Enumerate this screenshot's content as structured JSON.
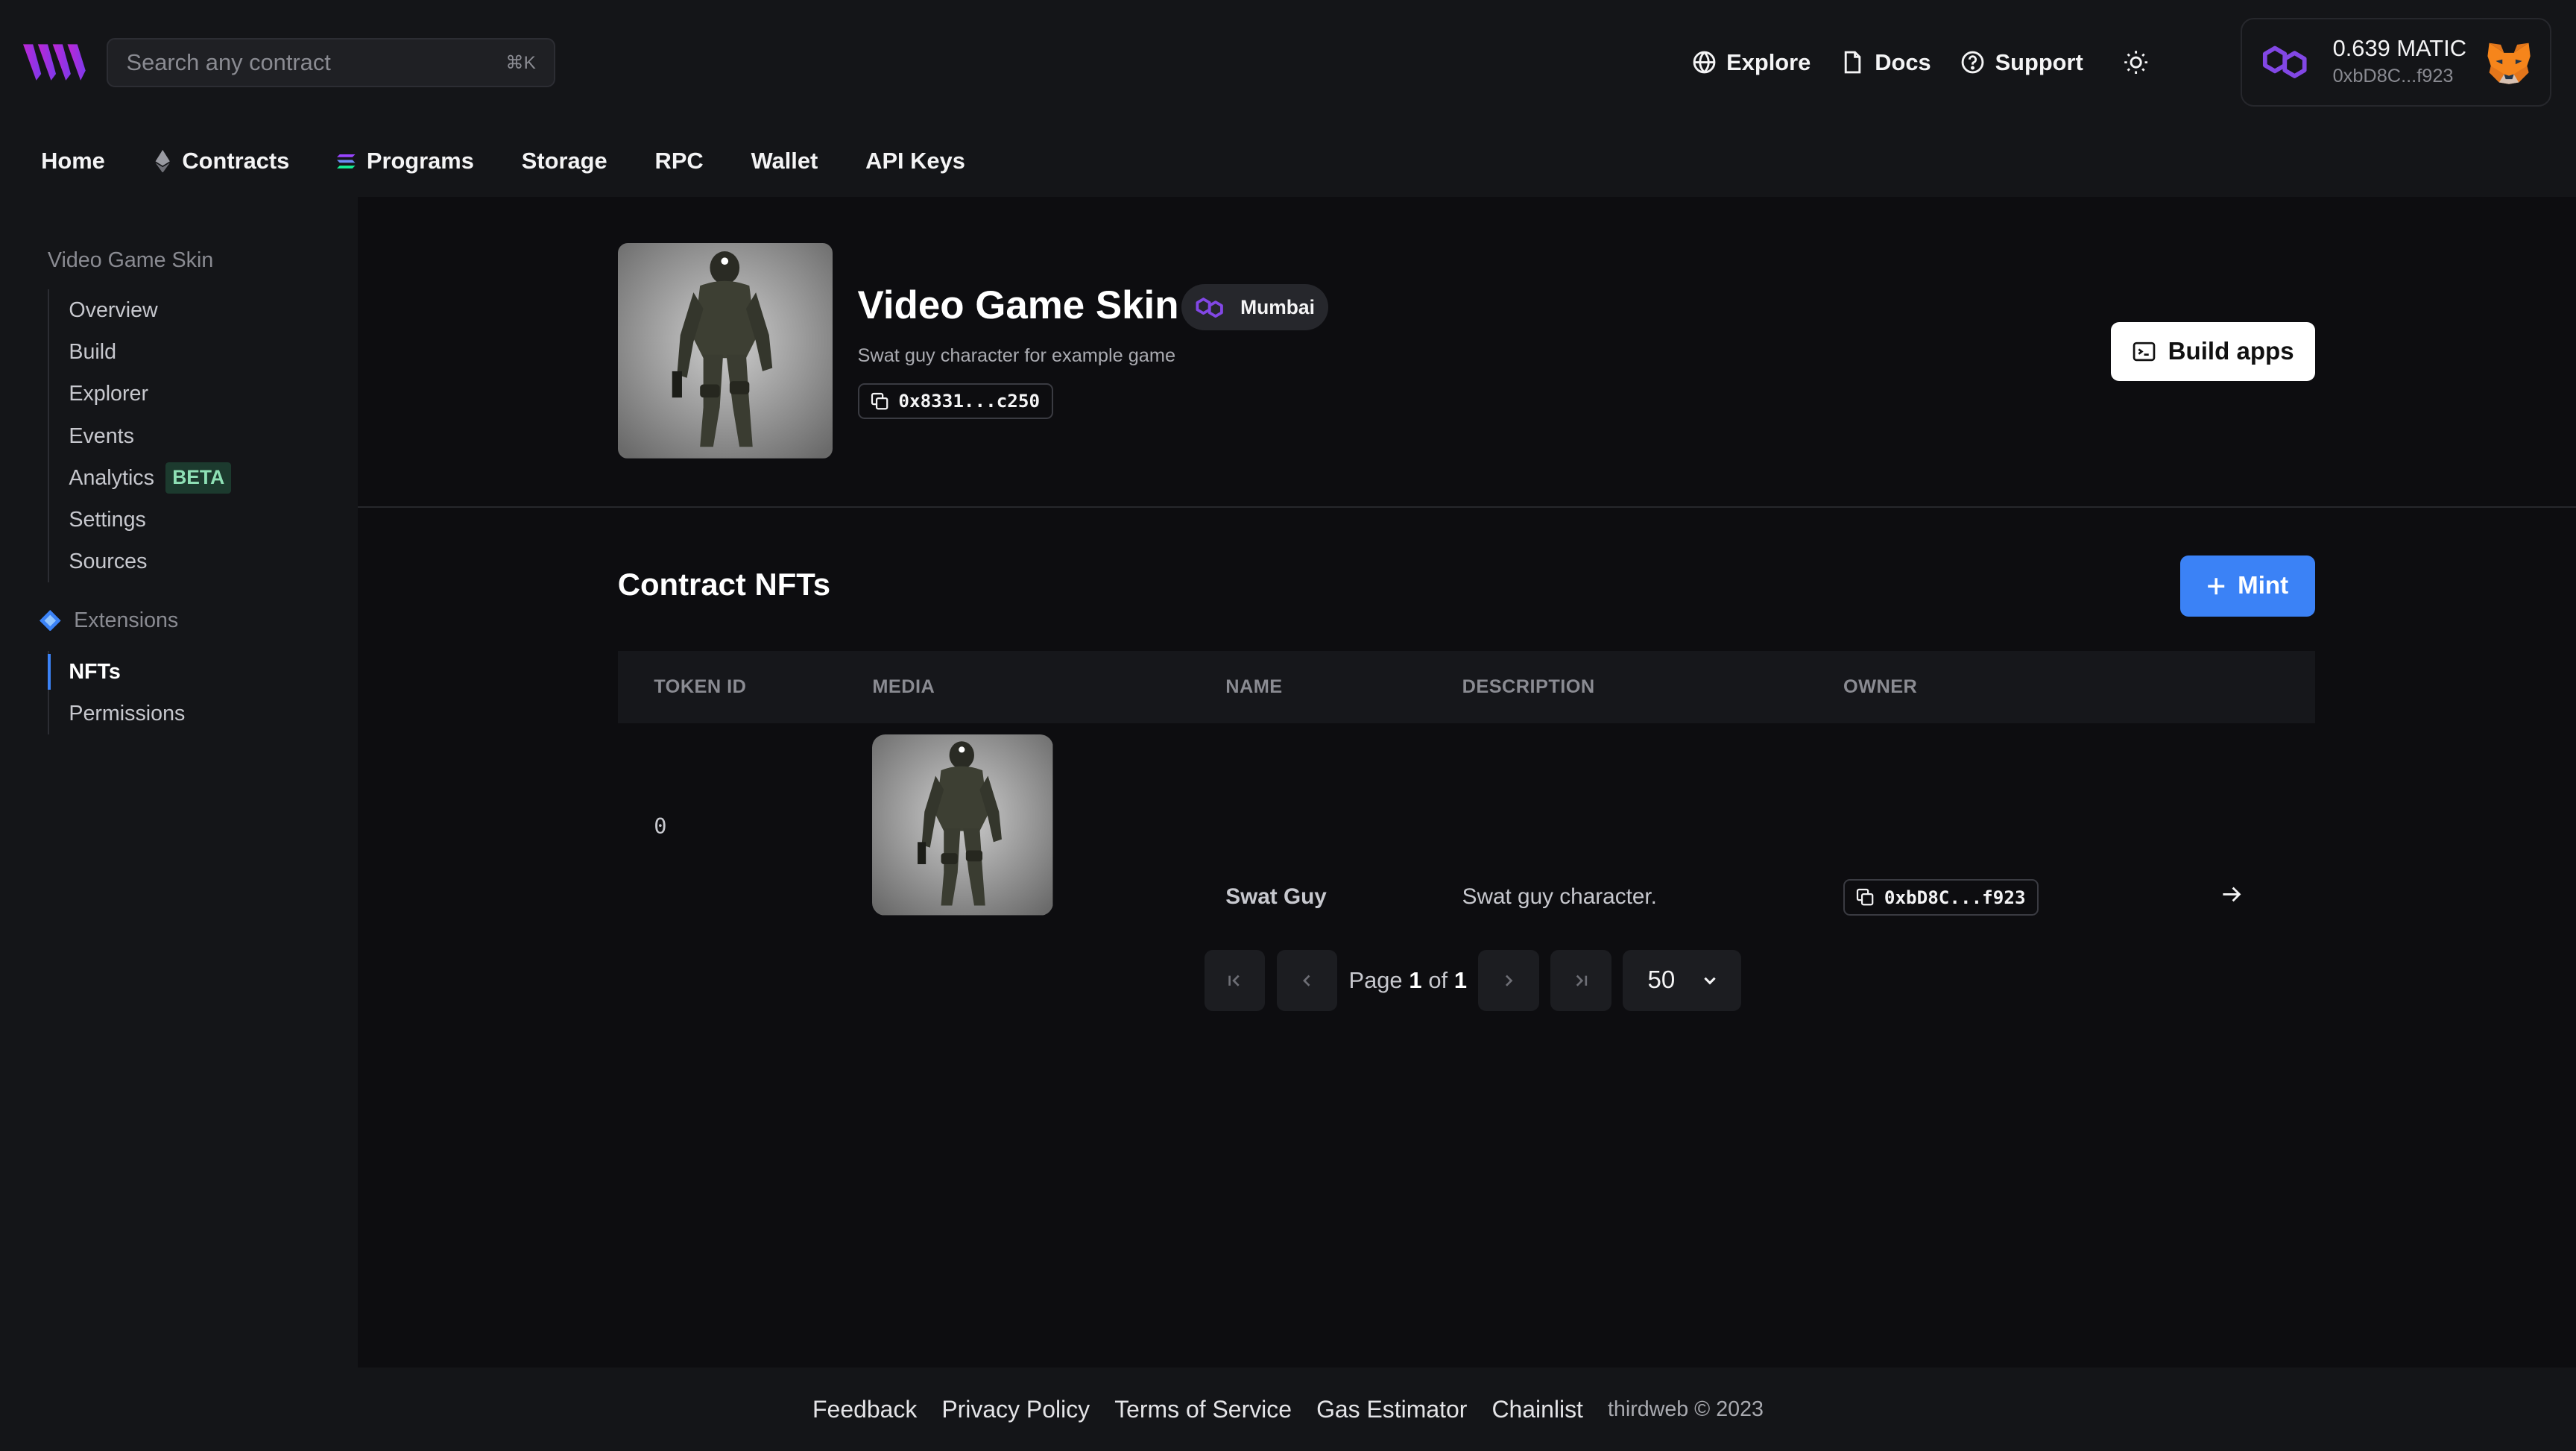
{
  "app": {
    "brand": "thirdweb"
  },
  "search": {
    "placeholder": "Search any contract",
    "shortcut": "⌘K"
  },
  "top_links": [
    {
      "label": "Explore",
      "icon": "globe-icon"
    },
    {
      "label": "Docs",
      "icon": "file-icon"
    },
    {
      "label": "Support",
      "icon": "help-circle-icon"
    }
  ],
  "wallet": {
    "balance": "0.639 MATIC",
    "address": "0xbD8C...f923"
  },
  "nav": [
    {
      "label": "Home"
    },
    {
      "label": "Contracts",
      "icon": "ethereum-icon"
    },
    {
      "label": "Programs",
      "icon": "solana-icon"
    },
    {
      "label": "Storage"
    },
    {
      "label": "RPC"
    },
    {
      "label": "Wallet"
    },
    {
      "label": "API Keys"
    }
  ],
  "sidebar": {
    "title": "Video Game Skin",
    "items": [
      {
        "label": "Overview"
      },
      {
        "label": "Build"
      },
      {
        "label": "Explorer"
      },
      {
        "label": "Events"
      },
      {
        "label": "Analytics",
        "badge": "BETA"
      },
      {
        "label": "Settings"
      },
      {
        "label": "Sources"
      }
    ],
    "extensions_label": "Extensions",
    "extension_items": [
      {
        "label": "NFTs",
        "active": true
      },
      {
        "label": "Permissions"
      }
    ]
  },
  "contract": {
    "name": "Video Game Skin",
    "network": "Mumbai",
    "description": "Swat guy character for example game",
    "address": "0x8331...c250",
    "build_label": "Build apps"
  },
  "nfts": {
    "title": "Contract NFTs",
    "mint_label": "Mint",
    "columns": [
      "TOKEN ID",
      "MEDIA",
      "NAME",
      "DESCRIPTION",
      "OWNER"
    ],
    "rows": [
      {
        "token_id": "0",
        "name": "Swat Guy",
        "description": "Swat guy character.",
        "owner": "0xbD8C...f923"
      }
    ],
    "pagination": {
      "page_word": "Page",
      "current": "1",
      "of_word": "of",
      "total": "1",
      "page_size": "50"
    }
  },
  "footer": {
    "links": [
      "Feedback",
      "Privacy Policy",
      "Terms of Service",
      "Gas Estimator",
      "Chainlist"
    ],
    "copyright": "thirdweb © 2023"
  },
  "colors": {
    "accent": "#3b82f6",
    "background": "#0d0d10",
    "panel": "#141518",
    "badge_green": "#8ee0b5"
  }
}
